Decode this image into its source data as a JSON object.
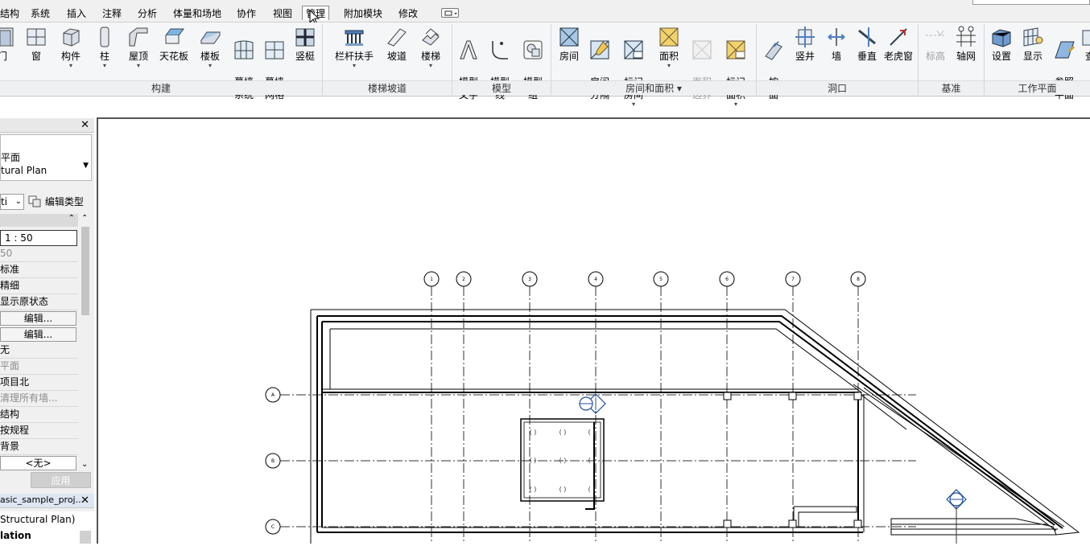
{
  "menubar": {
    "items": [
      "结构",
      "系统",
      "插入",
      "注释",
      "分析",
      "体量和场地",
      "协作",
      "视图",
      "管理",
      "附加模块",
      "修改"
    ],
    "active": "管理"
  },
  "ribbon": {
    "build": {
      "tools": [
        "门",
        "窗",
        "构件",
        "柱",
        "屋顶",
        "天花板",
        "楼板",
        "幕墙\n系统",
        "幕墙\n网格",
        "竖梃"
      ],
      "label": "构建"
    },
    "stairs": {
      "tools": [
        "栏杆扶手",
        "坡道",
        "楼梯"
      ],
      "label": "楼梯坡道"
    },
    "model": {
      "tools": [
        "模型\n文字",
        "模型\n线",
        "模型\n组"
      ],
      "label": "模型"
    },
    "room": {
      "tools": [
        "房间",
        "房间\n分隔",
        "标记\n房间",
        "面积",
        "面积\n边界",
        "标记\n面积"
      ],
      "label": "房间和面积"
    },
    "opening": {
      "tools": [
        "按\n面",
        "竖井",
        "墙",
        "垂直",
        "老虎窗"
      ],
      "label": "洞口"
    },
    "datum": {
      "tools": [
        "标高",
        "轴网"
      ],
      "label": "基准"
    },
    "workplane": {
      "tools": [
        "设置",
        "显示",
        "参照\n平面",
        "查"
      ],
      "label": "工作平面"
    }
  },
  "properties": {
    "type_line1": "平面",
    "type_line2": "tural Plan",
    "edit_type_label": "编辑类型",
    "view_dropdown": "ti",
    "rows": [
      "1 : 50",
      "50",
      "标准",
      "精细",
      "显示原状态",
      "编辑...",
      "编辑...",
      "无",
      "平面",
      "项目北",
      "清理所有墙...",
      "结构",
      "按规程",
      "背景",
      "<无>"
    ],
    "apply": "应用"
  },
  "browser": {
    "title": "asic_sample_proj...",
    "items": [
      "Structural Plan)",
      "lation"
    ]
  },
  "drawing": {
    "grid_columns": [
      "1",
      "2",
      "3",
      "4",
      "5",
      "6",
      "7",
      "8"
    ],
    "grid_rows": [
      "A",
      "B",
      "C"
    ]
  }
}
